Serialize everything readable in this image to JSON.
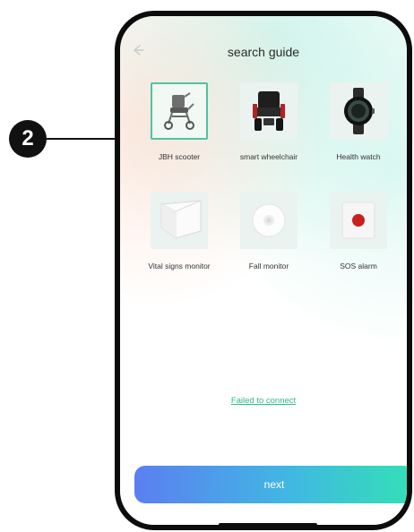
{
  "callout": {
    "number": "2"
  },
  "header": {
    "back_icon": "arrow-left-icon",
    "title": "search guide"
  },
  "devices": [
    {
      "label": "JBH scooter",
      "icon": "scooter-icon",
      "selected": true
    },
    {
      "label": "smart wheelchair",
      "icon": "wheelchair-icon",
      "selected": false
    },
    {
      "label": "Health watch",
      "icon": "watch-icon",
      "selected": false
    },
    {
      "label": "Vital signs monitor",
      "icon": "vital-monitor-icon",
      "selected": false
    },
    {
      "label": "Fall monitor",
      "icon": "fall-monitor-icon",
      "selected": false
    },
    {
      "label": "SOS alarm",
      "icon": "sos-alarm-icon",
      "selected": false
    }
  ],
  "failed_link": "Failed to connect",
  "next_label": "next",
  "colors": {
    "accent": "#4fc3a1",
    "link": "#2fb98c",
    "button_gradient_start": "#5b7ff0",
    "button_gradient_end": "#33e0b5"
  }
}
